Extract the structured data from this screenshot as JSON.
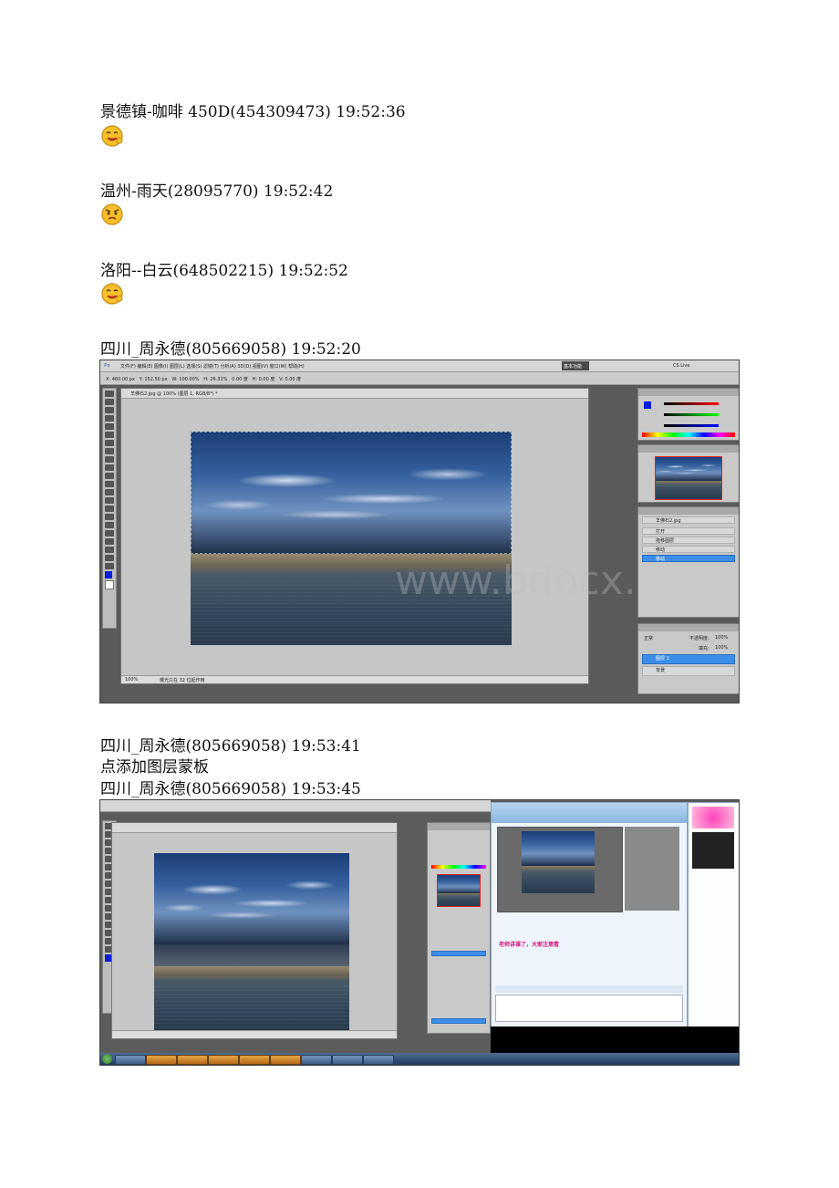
{
  "messages": [
    {
      "header": "景德镇-咖啡 450D(454309473)  19:52:36",
      "emoji": "smile-emoji"
    },
    {
      "header": "温州-雨天(28095770)  19:52:42",
      "emoji": "annoyed-emoji"
    },
    {
      "header": "洛阳--白云(648502215)  19:52:52",
      "emoji": "smile-emoji"
    },
    {
      "header": "四川_周永德(805669058)  19:52:20"
    },
    {
      "header": "四川_周永德(805669058)  19:53:41",
      "text": "点添加图层蒙板"
    },
    {
      "header": "四川_周永德(805669058)  19:53:45"
    }
  ],
  "screenshot1": {
    "doc_title": "羊佛石2.jpg @ 100% (图层 1, RGB/8*) *",
    "zoom": "100%",
    "status": "曝光只在 32 位起作用",
    "watermark": "www.bdocx.com",
    "history_title": "羊佛石2.jpg",
    "history_items": [
      "打开",
      "拖移图层",
      "移动",
      "移动"
    ],
    "layers_mode": "正常",
    "layers_opacity_label": "不透明度:",
    "layers_opacity": "100%",
    "layers_fill_label": "填充:",
    "layers_fill": "100%",
    "layers": [
      "图层 1",
      "背景"
    ],
    "workspace": "基本功能",
    "cs_live": "CS Live"
  },
  "screenshot2": {
    "chat_lines": [
      "老师讲课了，大家注意看"
    ],
    "chat_color": "#d6157a"
  },
  "colors": {
    "ps_bg": "#5a5a5a",
    "selection_blue": "#3d8ee8",
    "taskbar": "#1f3a5b"
  }
}
